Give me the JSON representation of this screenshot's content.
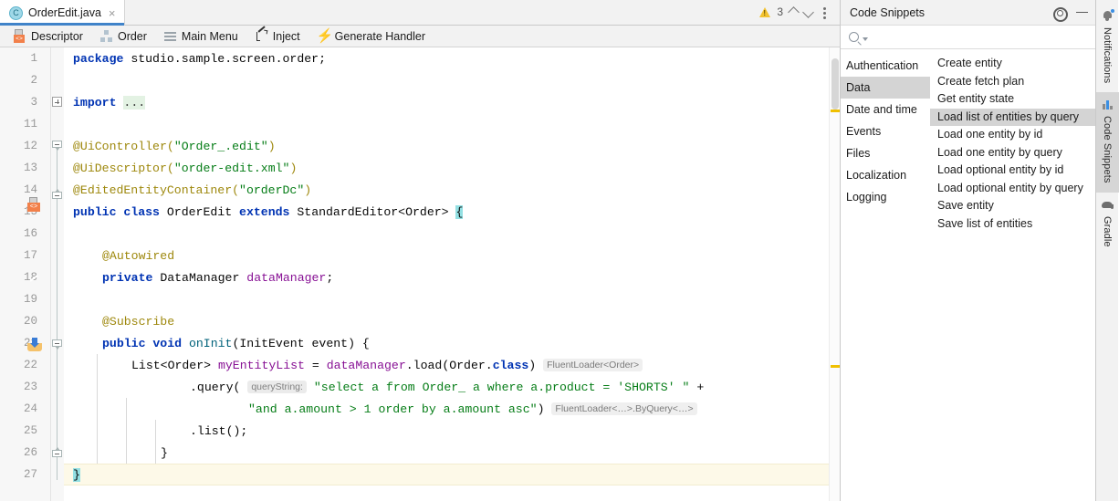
{
  "editor": {
    "tab": {
      "label": "OrderEdit.java",
      "icon": "java-class-icon",
      "close_icon": "×",
      "letter": "C"
    },
    "kebab_icon": "more-vertical-icon",
    "navbar": [
      {
        "label": "Descriptor",
        "icon": "descriptor-icon"
      },
      {
        "label": "Order",
        "icon": "screen-icon"
      },
      {
        "label": "Main Menu",
        "icon": "menu-icon"
      },
      {
        "label": "Inject",
        "icon": "inject-icon"
      },
      {
        "label": "Generate Handler",
        "icon": "lightning-icon"
      }
    ],
    "inspection": {
      "warning_icon": "warning-triangle-icon",
      "warning_count": "3",
      "prev_icon": "chevron-up-icon",
      "next_icon": "chevron-down-icon"
    },
    "line_numbers": [
      "1",
      "2",
      "3",
      "11",
      "12",
      "13",
      "14",
      "15",
      "16",
      "17",
      "18",
      "19",
      "20",
      "21",
      "22",
      "23",
      "24",
      "25",
      "26",
      "27"
    ],
    "gutter_icons": [
      {
        "line": "15",
        "name": "descriptor-gutter-icon",
        "badge": "<>"
      },
      {
        "line": "18",
        "name": "spring-bean-gutter-icon"
      },
      {
        "line": "21",
        "name": "override-method-gutter-icon"
      }
    ],
    "code": {
      "l1": {
        "kw": "package",
        "rest": " studio.sample.screen.order;"
      },
      "l3": {
        "kw": "import",
        "placeholder": "..."
      },
      "l12": "@UiController(\"Order_.edit\")",
      "l12_ann": "@UiController",
      "l12_str": "\"Order_.edit\"",
      "l13_ann": "@UiDescriptor",
      "l13_str": "\"order-edit.xml\"",
      "l14_ann": "@EditedEntityContainer",
      "l14_str": "\"orderDc\"",
      "l15": {
        "kw1": "public",
        "kw2": "class",
        "name": " OrderEdit ",
        "kw3": "extends",
        "type": " StandardEditor<Order> ",
        "brace": "{"
      },
      "l17_ann": "@Autowired",
      "l18": {
        "kw": "private",
        "type": " DataManager ",
        "field": "dataManager",
        "semi": ";"
      },
      "l20_ann": "@Subscribe",
      "l21": {
        "kw1": "public",
        "kw2": " void ",
        "method": "onInit",
        "params": "(InitEvent event) {"
      },
      "l22": {
        "type": "List<Order> ",
        "var": "myEntityList",
        "eq": " = ",
        "recv": "dataManager",
        "call": ".load(Order.",
        "kwclass": "class",
        "close": ")",
        "hint": "FluentLoader<Order>"
      },
      "l23": {
        "call": ".query(",
        "hint": "queryString:",
        "str": "\"select a from Order_ a where a.product = 'SHORTS' \"",
        "plus": " +"
      },
      "l24": {
        "str": "\"and a.amount > 1 order by a.amount asc\"",
        "close": ")",
        "hint": "FluentLoader<…>.ByQuery<…>"
      },
      "l25": ".list();",
      "l26": "}",
      "l27": "}"
    }
  },
  "toolwindow": {
    "title": "Code Snippets",
    "gear_icon": "gear-icon",
    "minimize_icon": "minimize-icon",
    "search": {
      "icon": "search-icon",
      "dropdown_icon": "chevron-down-icon",
      "value": "",
      "placeholder": ""
    },
    "categories": [
      {
        "label": "Authentication",
        "selected": false
      },
      {
        "label": "Data",
        "selected": true
      },
      {
        "label": "Date and time",
        "selected": false
      },
      {
        "label": "Events",
        "selected": false
      },
      {
        "label": "Files",
        "selected": false
      },
      {
        "label": "Localization",
        "selected": false
      },
      {
        "label": "Logging",
        "selected": false
      }
    ],
    "snippets": [
      {
        "label": "Create entity",
        "selected": false
      },
      {
        "label": "Create fetch plan",
        "selected": false
      },
      {
        "label": "Get entity state",
        "selected": false
      },
      {
        "label": "Load list of entities by query",
        "selected": true
      },
      {
        "label": "Load one entity by id",
        "selected": false
      },
      {
        "label": "Load one entity by query",
        "selected": false
      },
      {
        "label": "Load optional entity by id",
        "selected": false
      },
      {
        "label": "Load optional entity by query",
        "selected": false
      },
      {
        "label": "Save entity",
        "selected": false
      },
      {
        "label": "Save list of entities",
        "selected": false
      }
    ]
  },
  "tool_tabs": [
    {
      "label": "Notifications",
      "icon": "bell-icon",
      "selected": false,
      "badge": true
    },
    {
      "label": "Code Snippets",
      "icon": "snippets-icon",
      "selected": true,
      "badge": false
    },
    {
      "label": "Gradle",
      "icon": "gradle-icon",
      "selected": false,
      "badge": false
    }
  ],
  "colors": {
    "accent": "#4083c9",
    "selection": "#d4d4d4",
    "keyword": "#0033b3",
    "string": "#067d17",
    "annotation": "#9e880d",
    "field": "#871094",
    "warning": "#f0c000",
    "caret_line": "#fdf9e8"
  }
}
